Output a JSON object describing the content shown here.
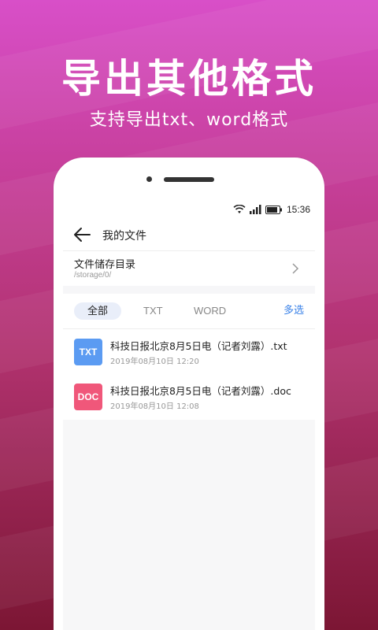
{
  "promo": {
    "headline": "导出其他格式",
    "subline": "支持导出txt、word格式"
  },
  "status_bar": {
    "time": "15:36",
    "icons": [
      "wifi-icon",
      "signal-icon",
      "battery-icon"
    ]
  },
  "app_bar": {
    "title": "我的文件",
    "back_icon": "arrow-left-icon"
  },
  "directory": {
    "title": "文件储存目录",
    "path": "/storage/0/",
    "icon": "chevron-right-icon"
  },
  "filter_tabs": {
    "all": "全部",
    "txt": "TXT",
    "word": "WORD",
    "selected": "全部",
    "multi_select": "多选"
  },
  "files": [
    {
      "badge": "TXT",
      "name": "科技日报北京8月5日电（记者刘露）.txt",
      "date": "2019年08月10日 12:20",
      "color": "#5b9bf2"
    },
    {
      "badge": "DOC",
      "name": "科技日报北京8月5日电（记者刘露）.doc",
      "date": "2019年08月10日 12:08",
      "color": "#f0577a"
    }
  ],
  "colors": {
    "background_top": "#d84fc8",
    "background_bottom": "#7c1634",
    "accent": "#3a82e8"
  }
}
